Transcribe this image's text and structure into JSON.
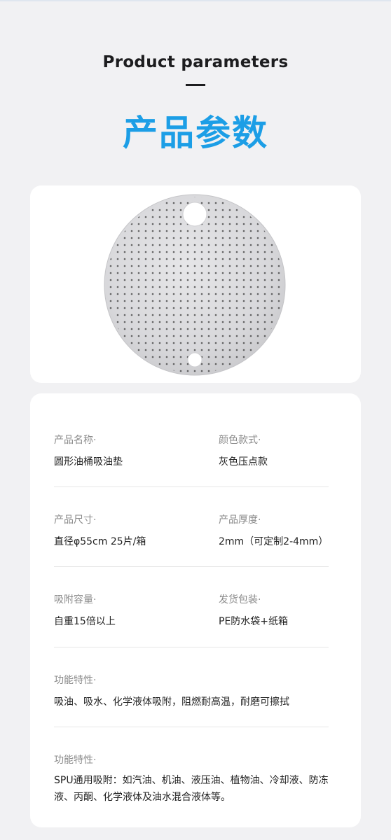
{
  "header": {
    "title_en": "Product parameters",
    "title_cn": "产品参数"
  },
  "product_image": {
    "icon": "round-drum-absorbent-pad",
    "color": "#dcdcde"
  },
  "params": [
    {
      "left": {
        "label": "产品名称·",
        "value": "圆形油桶吸油垫"
      },
      "right": {
        "label": "颜色款式·",
        "value": "灰色压点款"
      }
    },
    {
      "left": {
        "label": "产品尺寸·",
        "value": "直径φ55cm 25片/箱"
      },
      "right": {
        "label": "产品厚度·",
        "value": "2mm（可定制2-4mm）"
      }
    },
    {
      "left": {
        "label": "吸附容量·",
        "value": "自重15倍以上"
      },
      "right": {
        "label": "发货包装·",
        "value": "PE防水袋+纸箱"
      }
    }
  ],
  "features": [
    {
      "label": "功能特性·",
      "value": "吸油、吸水、化学液体吸附，阻燃耐高温，耐磨可擦拭"
    },
    {
      "label": "功能特性·",
      "value": "SPU通用吸附：如汽油、机油、液压油、植物油、冷却液、防冻液、丙酮、化学液体及油水混合液体等。"
    }
  ]
}
